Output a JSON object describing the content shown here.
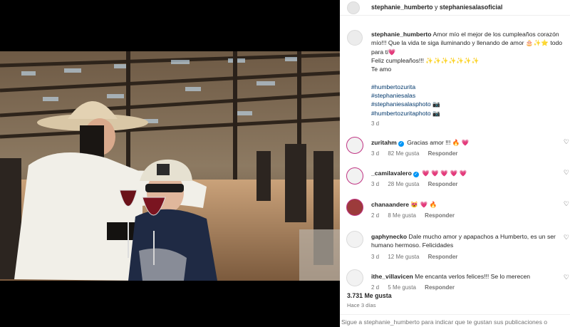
{
  "header": {
    "user1": "stephanie_humberto",
    "joiner": "y",
    "user2": "stephaniesalasoficial"
  },
  "caption": {
    "username": "stephanie_humberto",
    "text": "Amor mío el mejor de los cumpleaños corazón mío!!! Que la vida te siga iluminando y llenando de amor 🎂✨⭐ todo para ti💗",
    "line2": "Feliz cumpleaños!!! ✨✨✨✨✨✨✨",
    "line3": "Te amo",
    "tags": [
      "#humbertozurita",
      "#stephaniesalas",
      "#stephaniesalasphoto 📷",
      "#humbertozuritaphoto 📷"
    ],
    "time": "3 d"
  },
  "comments": [
    {
      "username": "zuritahm",
      "verified": true,
      "text": "Gracias amor !!! 🔥 💗",
      "time": "3 d",
      "likes": "82 Me gusta",
      "reply": "Responder"
    },
    {
      "username": "_camilavalero",
      "verified": true,
      "text": "💗 💗 💗 💗 💗",
      "time": "3 d",
      "likes": "28 Me gusta",
      "reply": "Responder"
    },
    {
      "username": "chanaandere",
      "verified": false,
      "text": "😻 💗 🔥",
      "time": "2 d",
      "likes": "8 Me gusta",
      "reply": "Responder"
    },
    {
      "username": "gaphynecko",
      "verified": false,
      "text": "Dale mucho amor y apapachos a Humberto, es un ser humano hermoso. Felicidades",
      "time": "3 d",
      "likes": "12 Me gusta",
      "reply": "Responder"
    },
    {
      "username": "ithe_villavicen",
      "verified": false,
      "text": "Me encanta verlos felices!!! Se lo merecen",
      "time": "2 d",
      "likes": "5 Me gusta",
      "reply": "Responder"
    }
  ],
  "likes": "3.731 Me gusta",
  "posted": "Hace 3 días",
  "footer": "Sigue a stephanie_humberto para indicar que te gustan sus publicaciones o",
  "icons": {
    "like": "heart-outline-icon",
    "verified": "verified-badge-icon"
  },
  "colors": {
    "link": "#00376b",
    "muted": "#737373",
    "verified": "#0095f6"
  }
}
